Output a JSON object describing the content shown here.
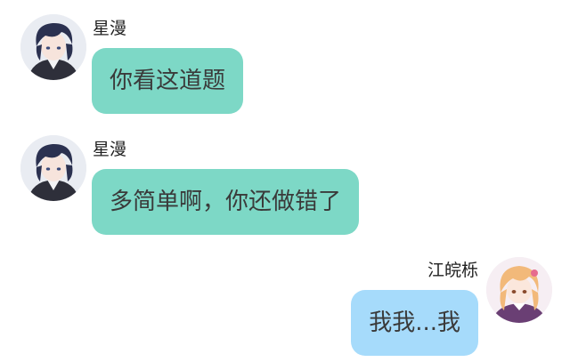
{
  "messages": [
    {
      "sender": "星漫",
      "text": "你看这道题",
      "side": "left",
      "bubble_color": "#7dd8c6",
      "avatar_icon": "dark-hair-boy-avatar"
    },
    {
      "sender": "星漫",
      "text": "多简单啊，你还做错了",
      "side": "left",
      "bubble_color": "#7dd8c6",
      "avatar_icon": "dark-hair-boy-avatar"
    },
    {
      "sender": "江皖栎",
      "text": "我我...我",
      "side": "right",
      "bubble_color": "#a6dbfb",
      "avatar_icon": "orange-hair-girl-avatar"
    }
  ]
}
